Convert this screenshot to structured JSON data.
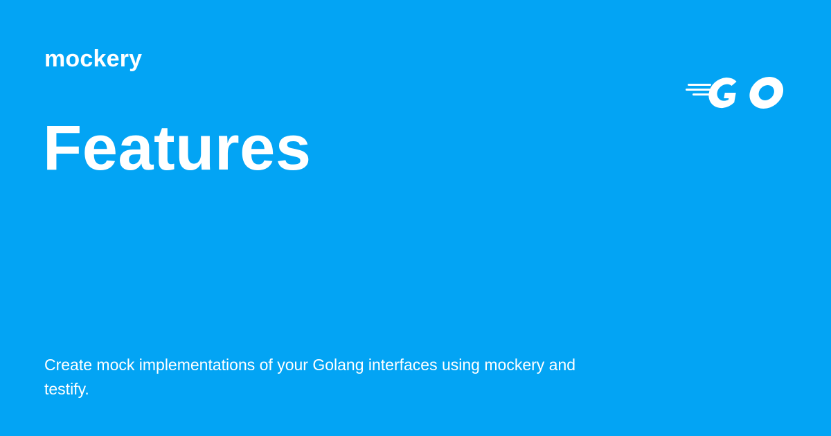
{
  "site": {
    "name": "mockery"
  },
  "page": {
    "title": "Features",
    "description": "Create mock implementations of your Golang interfaces using mockery and testify."
  },
  "logo": {
    "icon": "go-logo-icon",
    "text": "GO"
  },
  "colors": {
    "background": "#03A4F4",
    "text": "#FFFFFF"
  }
}
